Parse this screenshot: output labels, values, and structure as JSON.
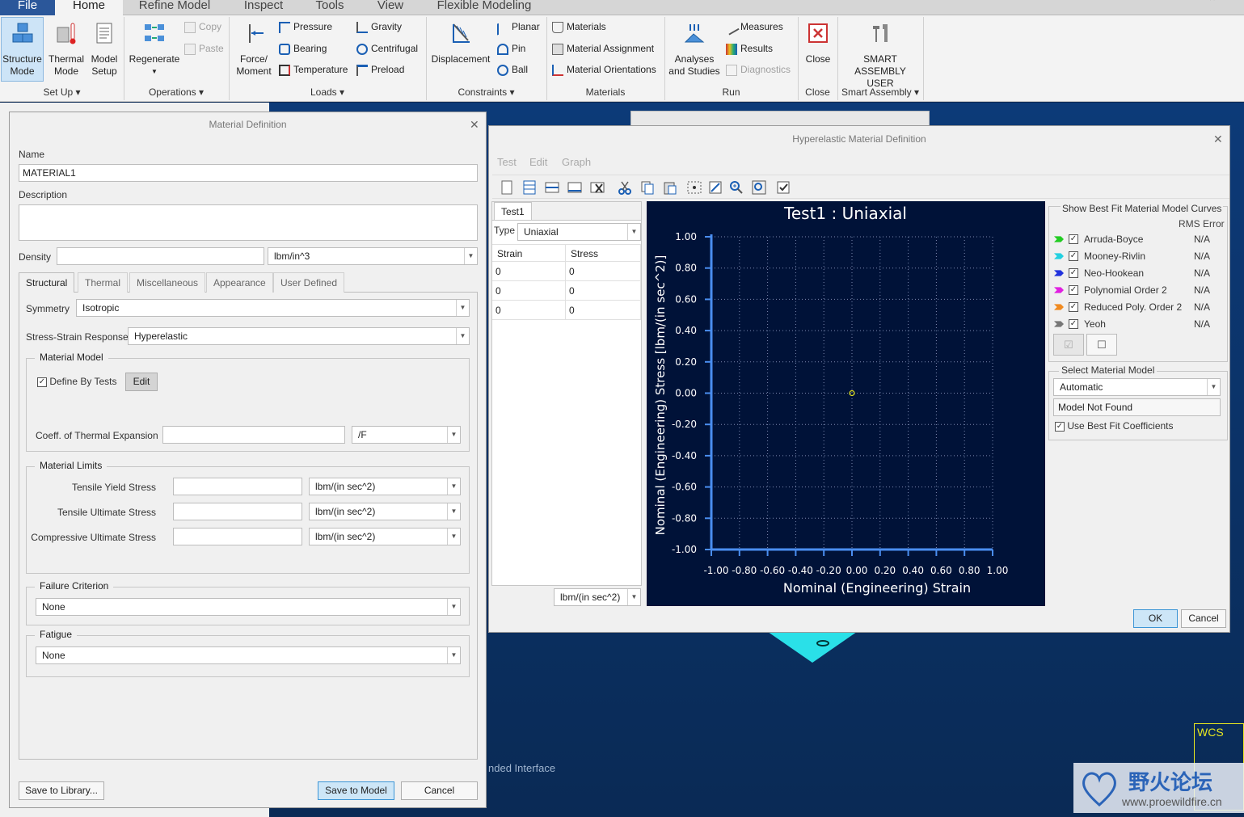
{
  "ribbon": {
    "tabs": [
      "File",
      "Home",
      "Refine Model",
      "Inspect",
      "Tools",
      "View",
      "Flexible Modeling"
    ],
    "active_tab": "Home",
    "setup": {
      "structure_mode": [
        "Structure",
        "Mode"
      ],
      "thermal_mode": [
        "Thermal",
        "Mode"
      ],
      "model_setup": [
        "Model",
        "Setup"
      ],
      "label": "Set Up"
    },
    "operations": {
      "regenerate": "Regenerate",
      "copy": "Copy",
      "paste": "Paste",
      "label": "Operations"
    },
    "loads": {
      "force": [
        "Force/",
        "Moment"
      ],
      "pressure": "Pressure",
      "bearing": "Bearing",
      "temperature": "Temperature",
      "gravity": "Gravity",
      "centrifugal": "Centrifugal",
      "preload": "Preload",
      "label": "Loads"
    },
    "constraints": {
      "displacement": "Displacement",
      "planar": "Planar",
      "pin": "Pin",
      "ball": "Ball",
      "label": "Constraints"
    },
    "materials": {
      "materials": "Materials",
      "assignment": "Material Assignment",
      "orientations": "Material Orientations",
      "label": "Materials"
    },
    "run": {
      "analyses": [
        "Analyses",
        "and Studies"
      ],
      "measures": "Measures",
      "results": "Results",
      "diagnostics": "Diagnostics",
      "label": "Run"
    },
    "close": {
      "close": "Close",
      "label": "Close"
    },
    "smart": {
      "smart": [
        "SMART",
        "ASSEMBLY USER"
      ],
      "label": "Smart Assembly"
    }
  },
  "background": {
    "extended_text": "nded Interface",
    "wcs": "WCS",
    "watermark_cn": "野火论坛",
    "watermark_url": "www.proewildfire.cn"
  },
  "material_dialog": {
    "title": "Material Definition",
    "name_label": "Name",
    "name_value": "MATERIAL1",
    "description_label": "Description",
    "density_label": "Density",
    "density_unit": "lbm/in^3",
    "tabs": [
      "Structural",
      "Thermal",
      "Miscellaneous",
      "Appearance",
      "User Defined"
    ],
    "symmetry_label": "Symmetry",
    "symmetry_value": "Isotropic",
    "response_label": "Stress-Strain Response",
    "response_value": "Hyperelastic",
    "material_model_label": "Material Model",
    "define_by_tests": "Define By Tests",
    "edit_button": "Edit",
    "cte_label": "Coeff. of Thermal Expansion",
    "cte_unit": "/F",
    "limits_label": "Material Limits",
    "limits": [
      {
        "label": "Tensile Yield Stress",
        "unit": "lbm/(in sec^2)"
      },
      {
        "label": "Tensile Ultimate Stress",
        "unit": "lbm/(in sec^2)"
      },
      {
        "label": "Compressive Ultimate Stress",
        "unit": "lbm/(in sec^2)"
      }
    ],
    "failure_label": "Failure Criterion",
    "failure_value": "None",
    "fatigue_label": "Fatigue",
    "fatigue_value": "None",
    "save_library": "Save to Library...",
    "save_model": "Save to Model",
    "cancel": "Cancel"
  },
  "hyper_dialog": {
    "title": "Hyperelastic Material Definition",
    "menu": [
      "Test",
      "Edit",
      "Graph"
    ],
    "test_tab": "Test1",
    "type_label": "Type",
    "type_value": "Uniaxial",
    "columns": [
      "Strain",
      "Stress"
    ],
    "rows": [
      [
        "0",
        "0"
      ],
      [
        "0",
        "0"
      ],
      [
        "0",
        "0"
      ]
    ],
    "stress_unit": "lbm/(in sec^2)",
    "best_fit_label": "Show Best Fit Material Model Curves",
    "rms_label": "RMS Error",
    "models": [
      {
        "name": "Arruda-Boyce",
        "rms": "N/A",
        "color": "#22cc22"
      },
      {
        "name": "Mooney-Rivlin",
        "rms": "N/A",
        "color": "#22d0e0"
      },
      {
        "name": "Neo-Hookean",
        "rms": "N/A",
        "color": "#2233dd"
      },
      {
        "name": "Polynomial Order 2",
        "rms": "N/A",
        "color": "#e020e0"
      },
      {
        "name": "Reduced Poly. Order 2",
        "rms": "N/A",
        "color": "#f08a20"
      },
      {
        "name": "Yeoh",
        "rms": "N/A",
        "color": "#777777"
      }
    ],
    "select_model_label": "Select Material Model",
    "select_model_value": "Automatic",
    "model_status": "Model Not Found",
    "use_best_fit": "Use Best Fit Coefficients",
    "ok": "OK",
    "cancel": "Cancel"
  },
  "chart_data": {
    "type": "scatter",
    "title": "Test1 : Uniaxial",
    "xlabel": "Nominal (Engineering) Strain",
    "ylabel": "Nominal (Engineering) Stress [lbm/(in sec^2)]",
    "xlim": [
      -1.0,
      1.0
    ],
    "ylim": [
      -1.0,
      1.0
    ],
    "x_ticks": [
      "-1.00",
      "-0.80",
      "-0.60",
      "-0.40",
      "-0.20",
      "0.00",
      "0.20",
      "0.40",
      "0.60",
      "0.80",
      "1.00"
    ],
    "y_ticks": [
      "1.00",
      "0.80",
      "0.60",
      "0.40",
      "0.20",
      "0.00",
      "-0.20",
      "-0.40",
      "-0.60",
      "-0.80",
      "-1.00"
    ],
    "grid": true,
    "points": [
      {
        "x": 0,
        "y": 0
      }
    ],
    "colors": {
      "background": "#001238",
      "axis": "#4a8ef0",
      "grid": "#7a8ab0",
      "point": "#e8e820"
    }
  }
}
